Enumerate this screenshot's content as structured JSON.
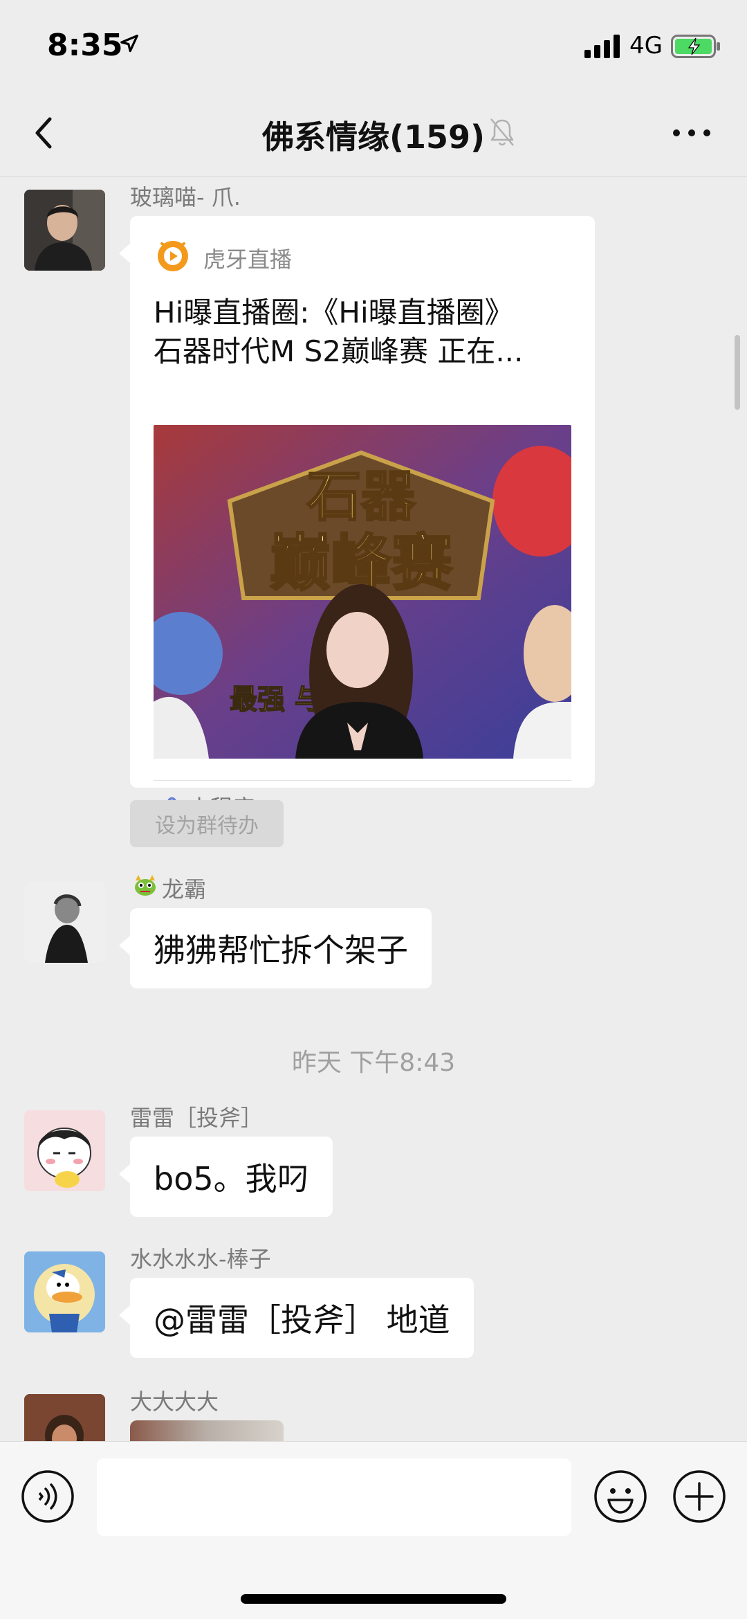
{
  "status_bar": {
    "time": "8:35",
    "network": "4G"
  },
  "header": {
    "title": "佛系情缘(159)",
    "muted": true
  },
  "messages": [
    {
      "sender": "玻璃喵- 爪.",
      "type": "mini-program",
      "card": {
        "source": "虎牙直播",
        "line1": "Hi曝直播圈:《Hi曝直播圈》",
        "line2": "石器时代M S2巅峰赛 正在...",
        "thumb_title_1": "石器",
        "thumb_title_2": "巅峰赛",
        "thumb_caption": "最强 与争锋",
        "footer": "小程序"
      },
      "action": "设为群待办"
    },
    {
      "sender": "龙霸",
      "text": "狒狒帮忙拆个架子"
    },
    {
      "timestamp": "昨天 下午8:43"
    },
    {
      "sender": "雷雷［投斧］",
      "text": "bo5。我叼"
    },
    {
      "sender": "水水水水-棒子",
      "text": "@雷雷［投斧］ 地道"
    },
    {
      "sender": "大大大大"
    }
  ],
  "colors": {
    "background": "#ededed",
    "bubble": "#ffffff",
    "accent_orange": "#f39a1d",
    "mini_program": "#6b7fd6"
  },
  "input": {
    "value": ""
  }
}
